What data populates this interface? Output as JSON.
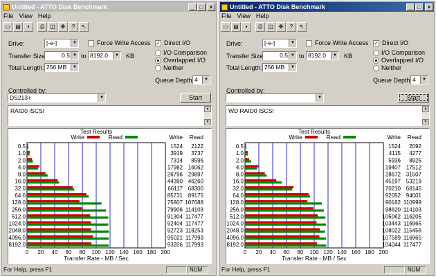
{
  "windows": [
    {
      "title": "Untitled - ATTO Disk Benchmark",
      "active": false,
      "menu": [
        "File",
        "View",
        "Help"
      ],
      "drive_label": "Drive:",
      "drive_value": "[-e-]",
      "force_write_label": "Force Write Access",
      "force_write_checked": false,
      "direct_io_label": "Direct I/O",
      "direct_io_checked": true,
      "transfer_size_label": "Transfer Size:",
      "transfer_from": "0.5",
      "transfer_to_label": "to",
      "transfer_to": "8192.0",
      "transfer_unit": "KB",
      "total_length_label": "Total Length:",
      "total_length": "256 MB",
      "radio_io_comparison": "I/O Comparison",
      "radio_overlapped": "Overlapped I/O",
      "radio_neither": "Neither",
      "radio_selected": "overlapped",
      "queue_depth_label": "Queue Depth:",
      "queue_depth": "4",
      "controlled_by_label": "Controlled by:",
      "controlled_by": "DS213+",
      "start_label": "Start",
      "description": "RAID0 iSCSI",
      "results_title": "Test Results",
      "legend_write": "Write",
      "legend_read": "Read",
      "col_write": "Write",
      "col_read": "Read",
      "x_axis_label": "Transfer Rate - MB / Sec",
      "status_text": "For Help, press F1",
      "status_num": "NUM",
      "chart_data": {
        "type": "bar",
        "orientation": "horizontal",
        "categories": [
          "0.5",
          "1.0",
          "2.0",
          "4.0",
          "8.0",
          "16.0",
          "32.0",
          "64.0",
          "128.0",
          "256.0",
          "512.0",
          "1024.0",
          "2048.0",
          "4096.0",
          "8192.0"
        ],
        "series": [
          {
            "name": "Write",
            "color": "#cc0000",
            "values": [
              1524,
              3919,
              7314,
              17982,
              26796,
              44390,
              66117,
              85731,
              75807,
              79906,
              91304,
              92404,
              92723,
              95021,
              93206
            ]
          },
          {
            "name": "Read",
            "color": "#008800",
            "values": [
              2122,
              3737,
              8596,
              16062,
              29897,
              46260,
              68300,
              89175,
              107688,
              114103,
              117477,
              117477,
              118253,
              117993,
              117993
            ]
          }
        ],
        "xlabel": "Transfer Rate - MB / Sec",
        "xticks": [
          "0",
          "20",
          "40",
          "60",
          "80",
          "100",
          "120",
          "140",
          "160",
          "180",
          "200"
        ],
        "xlim": [
          0,
          200
        ]
      }
    },
    {
      "title": "Untitled - ATTO Disk Benchmark",
      "active": true,
      "menu": [
        "File",
        "View",
        "Help"
      ],
      "drive_label": "Drive:",
      "drive_value": "[-e-]",
      "force_write_label": "Force Write Access",
      "force_write_checked": false,
      "direct_io_label": "Direct I/O",
      "direct_io_checked": true,
      "transfer_size_label": "Transfer Size:",
      "transfer_from": "0.5",
      "transfer_to_label": "to",
      "transfer_to": "8192.0",
      "transfer_unit": "KB",
      "total_length_label": "Total Length:",
      "total_length": "256 MB",
      "radio_io_comparison": "I/O Comparison",
      "radio_overlapped": "Overlapped I/O",
      "radio_neither": "Neither",
      "radio_selected": "overlapped",
      "queue_depth_label": "Queue Depth:",
      "queue_depth": "4",
      "controlled_by_label": "Controlled by:",
      "controlled_by": "",
      "start_label": "Start",
      "description": "WD RAID0 iSCSI",
      "results_title": "Test Results",
      "legend_write": "Write",
      "legend_read": "Read",
      "col_write": "Write",
      "col_read": "Read",
      "x_axis_label": "Transfer Rate - MB / Sec",
      "status_text": "For Help, press F1",
      "status_num": "NUM",
      "chart_data": {
        "type": "bar",
        "orientation": "horizontal",
        "categories": [
          "0.5",
          "1.0",
          "2.0",
          "4.0",
          "8.0",
          "16.0",
          "32.0",
          "64.0",
          "128.0",
          "256.0",
          "512.0",
          "1024.0",
          "2048.0",
          "4096.0",
          "8192.0"
        ],
        "series": [
          {
            "name": "Write",
            "color": "#cc0000",
            "values": [
              1524,
              4115,
              5936,
              19407,
              28672,
              45197,
              70210,
              92052,
              90182,
              98620,
              105062,
              103443,
              108022,
              107589,
              104044
            ]
          },
          {
            "name": "Read",
            "color": "#008800",
            "values": [
              2092,
              4277,
              8925,
              17512,
              31507,
              53219,
              68145,
              94001,
              110999,
              114103,
              116205,
              116965,
              115456,
              116965,
              117477
            ]
          }
        ],
        "xlabel": "Transfer Rate - MB / Sec",
        "xticks": [
          "0",
          "20",
          "40",
          "60",
          "80",
          "100",
          "120",
          "140",
          "160",
          "180",
          "200"
        ],
        "xlim": [
          0,
          200
        ]
      }
    }
  ]
}
